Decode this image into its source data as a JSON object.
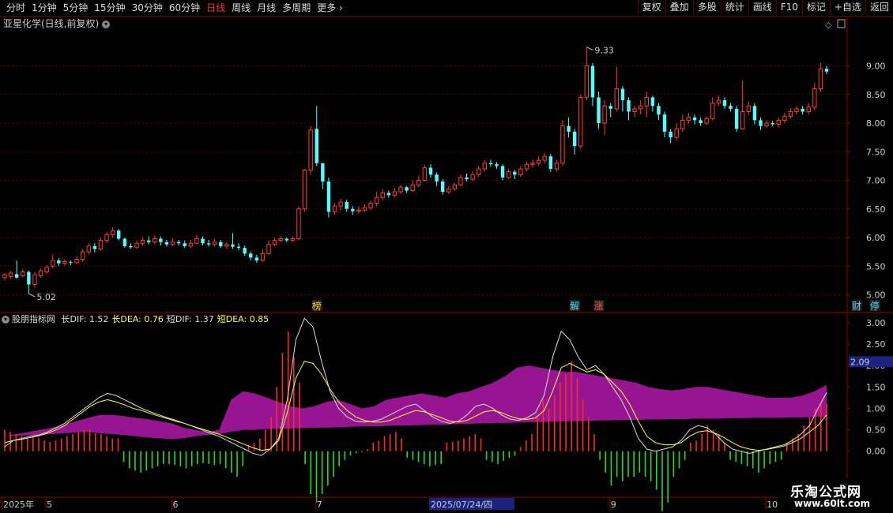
{
  "toolbar": {
    "periods": [
      "分时",
      "1分钟",
      "5分钟",
      "15分钟",
      "30分钟",
      "60分钟",
      "日线",
      "周线",
      "月线",
      "多周期",
      "更多"
    ],
    "active_period": "日线",
    "buttons": [
      "复权",
      "叠加",
      "多股",
      "统计",
      "画线",
      "F10",
      "标记",
      "+自选",
      "返回"
    ]
  },
  "stock_title": "亚星化学(日线,前复权)",
  "price_axis": [
    "9.00",
    "8.50",
    "8.00",
    "7.50",
    "7.00",
    "6.50",
    "6.00",
    "5.50",
    "5.00"
  ],
  "high_label": "9.33",
  "low_label": "5.02",
  "event_markers": [
    {
      "text": "榜",
      "color": "#ffcc33",
      "day": 52
    },
    {
      "text": "解",
      "color": "#55ddee",
      "day": 95
    },
    {
      "text": "涨",
      "color": "#ff5555",
      "day": 99
    },
    {
      "text": "财",
      "color": "#55ddee",
      "day": 142
    },
    {
      "text": "停",
      "color": "#55ddee",
      "day": 145
    }
  ],
  "indicator": {
    "name": "股朋指标网",
    "fields": [
      {
        "label": "长DIF: 1.52",
        "color": "#dddddd"
      },
      {
        "label": "长DEA: 0.76",
        "color": "#ffff33"
      },
      {
        "label": "短DIF: 1.37",
        "color": "#dddddd"
      },
      {
        "label": "短DEA: 0.85",
        "color": "#ffff33"
      }
    ],
    "axis": [
      "3.00",
      "2.50",
      "2.00",
      "1.50",
      "1.00",
      "0.50",
      "0.00"
    ],
    "current_value": "2.09"
  },
  "time_axis": [
    {
      "label": "2025年",
      "day": 0
    },
    {
      "label": "5",
      "day": 7
    },
    {
      "label": "6",
      "day": 28
    },
    {
      "label": "7",
      "day": 52
    },
    {
      "label": "2025/07/24/四",
      "day": 71,
      "highlight": true
    },
    {
      "label": "9",
      "day": 101
    },
    {
      "label": "10",
      "day": 127
    }
  ],
  "chart_data": {
    "type": "candlestick",
    "ylim": [
      4.8,
      9.6
    ],
    "candles": [
      [
        5.3,
        5.35,
        5.38,
        5.25
      ],
      [
        5.32,
        5.38,
        5.42,
        5.28
      ],
      [
        5.36,
        5.3,
        5.6,
        5.28
      ],
      [
        5.33,
        5.4,
        5.45,
        5.3
      ],
      [
        5.4,
        5.18,
        5.42,
        5.02
      ],
      [
        5.18,
        5.35,
        5.4,
        5.12
      ],
      [
        5.33,
        5.42,
        5.46,
        5.3
      ],
      [
        5.4,
        5.48,
        5.52,
        5.36
      ],
      [
        5.5,
        5.6,
        5.7,
        5.46
      ],
      [
        5.6,
        5.55,
        5.64,
        5.5
      ],
      [
        5.55,
        5.58,
        5.62,
        5.5
      ],
      [
        5.57,
        5.56,
        5.6,
        5.52
      ],
      [
        5.56,
        5.62,
        5.68,
        5.54
      ],
      [
        5.62,
        5.75,
        5.8,
        5.58
      ],
      [
        5.75,
        5.85,
        5.9,
        5.7
      ],
      [
        5.85,
        5.8,
        5.9,
        5.74
      ],
      [
        5.8,
        5.95,
        6.0,
        5.78
      ],
      [
        5.95,
        6.05,
        6.1,
        5.9
      ],
      [
        6.05,
        6.12,
        6.18,
        6.0
      ],
      [
        6.12,
        5.98,
        6.15,
        5.95
      ],
      [
        5.98,
        5.85,
        6.0,
        5.82
      ],
      [
        5.85,
        5.83,
        5.9,
        5.8
      ],
      [
        5.83,
        5.9,
        5.95,
        5.8
      ],
      [
        5.9,
        5.95,
        6.0,
        5.86
      ],
      [
        5.95,
        5.92,
        6.02,
        5.88
      ],
      [
        5.92,
        5.98,
        6.04,
        5.88
      ],
      [
        5.98,
        5.92,
        6.02,
        5.86
      ],
      [
        5.92,
        5.88,
        5.96,
        5.84
      ],
      [
        5.88,
        5.92,
        5.98,
        5.85
      ],
      [
        5.92,
        5.9,
        5.96,
        5.86
      ],
      [
        5.9,
        5.85,
        5.95,
        5.82
      ],
      [
        5.85,
        5.9,
        5.96,
        5.82
      ],
      [
        5.9,
        5.98,
        6.05,
        5.88
      ],
      [
        5.98,
        5.9,
        6.02,
        5.86
      ],
      [
        5.9,
        5.88,
        5.96,
        5.84
      ],
      [
        5.88,
        5.92,
        5.98,
        5.84
      ],
      [
        5.92,
        5.85,
        5.96,
        5.82
      ],
      [
        5.85,
        5.88,
        5.92,
        5.8
      ],
      [
        5.88,
        5.84,
        6.08,
        5.8
      ],
      [
        5.84,
        5.82,
        5.9,
        5.78
      ],
      [
        5.82,
        5.72,
        5.86,
        5.68
      ],
      [
        5.72,
        5.65,
        5.76,
        5.6
      ],
      [
        5.65,
        5.6,
        5.7,
        5.56
      ],
      [
        5.6,
        5.72,
        5.8,
        5.58
      ],
      [
        5.72,
        5.88,
        5.95,
        5.7
      ],
      [
        5.88,
        5.95,
        6.0,
        5.85
      ],
      [
        5.95,
        5.98,
        6.02,
        5.92
      ],
      [
        5.98,
        5.95,
        6.0,
        5.92
      ],
      [
        5.95,
        5.98,
        6.02,
        5.93
      ],
      [
        5.98,
        6.5,
        6.55,
        5.95
      ],
      [
        6.5,
        7.18,
        7.2,
        6.45
      ],
      [
        7.18,
        7.88,
        7.95,
        7.1
      ],
      [
        7.9,
        7.3,
        8.3,
        7.25
      ],
      [
        7.3,
        6.98,
        7.12,
        6.85
      ],
      [
        6.98,
        6.45,
        7.05,
        6.35
      ],
      [
        6.45,
        6.55,
        6.6,
        6.4
      ],
      [
        6.55,
        6.62,
        6.68,
        6.48
      ],
      [
        6.62,
        6.5,
        6.66,
        6.45
      ],
      [
        6.5,
        6.46,
        6.55,
        6.4
      ],
      [
        6.46,
        6.48,
        6.55,
        6.42
      ],
      [
        6.48,
        6.52,
        6.58,
        6.45
      ],
      [
        6.52,
        6.6,
        6.65,
        6.48
      ],
      [
        6.6,
        6.7,
        6.8,
        6.55
      ],
      [
        6.7,
        6.78,
        6.85,
        6.65
      ],
      [
        6.78,
        6.74,
        6.82,
        6.7
      ],
      [
        6.74,
        6.8,
        6.86,
        6.7
      ],
      [
        6.8,
        6.88,
        6.92,
        6.76
      ],
      [
        6.88,
        6.82,
        6.9,
        6.78
      ],
      [
        6.82,
        6.92,
        7.0,
        6.8
      ],
      [
        6.92,
        7.0,
        7.08,
        6.88
      ],
      [
        7.0,
        7.22,
        7.26,
        6.98
      ],
      [
        7.22,
        7.1,
        7.28,
        7.05
      ],
      [
        7.1,
        6.98,
        7.14,
        6.9
      ],
      [
        6.98,
        6.8,
        7.02,
        6.75
      ],
      [
        6.8,
        6.85,
        6.9,
        6.76
      ],
      [
        6.85,
        6.92,
        6.96,
        6.82
      ],
      [
        6.92,
        7.05,
        7.1,
        6.9
      ],
      [
        7.05,
        7.02,
        7.12,
        6.98
      ],
      [
        7.02,
        7.1,
        7.16,
        6.98
      ],
      [
        7.1,
        7.2,
        7.25,
        7.06
      ],
      [
        7.2,
        7.3,
        7.35,
        7.15
      ],
      [
        7.3,
        7.28,
        7.36,
        7.24
      ],
      [
        7.28,
        7.25,
        7.32,
        7.2
      ],
      [
        7.25,
        7.05,
        7.28,
        7.0
      ],
      [
        7.05,
        7.15,
        7.2,
        7.02
      ],
      [
        7.15,
        7.1,
        7.18,
        7.02
      ],
      [
        7.1,
        7.2,
        7.25,
        7.06
      ],
      [
        7.2,
        7.28,
        7.32,
        7.16
      ],
      [
        7.28,
        7.3,
        7.36,
        7.22
      ],
      [
        7.3,
        7.35,
        7.42,
        7.26
      ],
      [
        7.35,
        7.42,
        7.48,
        7.3
      ],
      [
        7.42,
        7.2,
        7.46,
        7.15
      ],
      [
        7.2,
        7.3,
        7.36,
        7.15
      ],
      [
        7.3,
        7.95,
        8.05,
        7.25
      ],
      [
        7.95,
        7.85,
        8.1,
        7.75
      ],
      [
        7.85,
        7.6,
        7.9,
        7.45
      ],
      [
        7.6,
        8.45,
        8.5,
        7.55
      ],
      [
        8.45,
        9.0,
        9.33,
        8.4
      ],
      [
        9.0,
        8.45,
        9.05,
        8.3
      ],
      [
        8.45,
        8.0,
        8.55,
        7.9
      ],
      [
        8.0,
        8.3,
        8.4,
        7.8
      ],
      [
        8.3,
        8.25,
        8.35,
        8.1
      ],
      [
        8.25,
        8.6,
        8.98,
        8.2
      ],
      [
        8.6,
        8.4,
        8.65,
        8.2
      ],
      [
        8.4,
        8.2,
        8.45,
        8.05
      ],
      [
        8.2,
        8.25,
        8.3,
        8.1
      ],
      [
        8.25,
        8.3,
        8.4,
        8.15
      ],
      [
        8.3,
        8.45,
        8.55,
        8.1
      ],
      [
        8.45,
        8.3,
        8.48,
        8.2
      ],
      [
        8.3,
        8.15,
        8.35,
        8.05
      ],
      [
        8.15,
        7.85,
        8.2,
        7.75
      ],
      [
        7.85,
        7.75,
        7.9,
        7.65
      ],
      [
        7.75,
        7.9,
        8.0,
        7.7
      ],
      [
        7.9,
        8.05,
        8.15,
        7.85
      ],
      [
        8.05,
        8.1,
        8.18,
        8.0
      ],
      [
        8.1,
        8.05,
        8.15,
        7.98
      ],
      [
        8.05,
        8.0,
        8.1,
        7.95
      ],
      [
        8.0,
        8.08,
        8.12,
        7.96
      ],
      [
        8.08,
        8.35,
        8.45,
        8.05
      ],
      [
        8.35,
        8.4,
        8.48,
        8.3
      ],
      [
        8.4,
        8.3,
        8.45,
        8.25
      ],
      [
        8.3,
        8.25,
        8.35,
        8.2
      ],
      [
        8.25,
        7.9,
        8.3,
        7.85
      ],
      [
        7.9,
        8.2,
        8.75,
        7.88
      ],
      [
        8.2,
        8.3,
        8.38,
        8.15
      ],
      [
        8.3,
        8.05,
        8.35,
        7.98
      ],
      [
        8.05,
        7.95,
        8.1,
        7.88
      ],
      [
        7.95,
        8.0,
        8.05,
        7.92
      ],
      [
        8.0,
        7.98,
        8.04,
        7.94
      ],
      [
        7.98,
        8.05,
        8.1,
        7.92
      ],
      [
        8.05,
        8.12,
        8.18,
        8.0
      ],
      [
        8.12,
        8.2,
        8.26,
        8.08
      ],
      [
        8.2,
        8.25,
        8.3,
        8.15
      ],
      [
        8.25,
        8.2,
        8.3,
        8.15
      ],
      [
        8.2,
        8.28,
        8.35,
        8.15
      ],
      [
        8.28,
        8.6,
        8.7,
        8.22
      ],
      [
        8.6,
        8.95,
        9.05,
        8.55
      ],
      [
        8.95,
        8.9,
        9.0,
        8.85
      ]
    ],
    "series": [
      {
        "name": "长DIF",
        "color": "#dddddd",
        "values": [
          0.1,
          0.25,
          0.3,
          0.35,
          0.38,
          0.45,
          0.55,
          0.65,
          0.8,
          0.95,
          1.1,
          1.25,
          1.35,
          1.3,
          1.2,
          1.1,
          1.0,
          0.92,
          0.85,
          0.78,
          0.72,
          0.65,
          0.58,
          0.5,
          0.42,
          0.35,
          0.25,
          0.15,
          0.05,
          -0.05,
          -0.1,
          0.05,
          0.3,
          1.2,
          2.6,
          3.1,
          2.9,
          2.1,
          1.4,
          1.0,
          0.8,
          0.7,
          0.68,
          0.7,
          0.75,
          0.85,
          0.95,
          1.05,
          1.1,
          0.95,
          0.8,
          0.7,
          0.65,
          0.7,
          0.85,
          1.05,
          1.1,
          1.0,
          0.85,
          0.75,
          0.72,
          0.78,
          0.9,
          1.3,
          2.2,
          2.8,
          2.6,
          2.2,
          1.9,
          2.0,
          1.8,
          1.5,
          1.2,
          0.8,
          0.3,
          0.05,
          0.0,
          0.05,
          0.1,
          0.25,
          0.5,
          0.6,
          0.55,
          0.4,
          0.2,
          0.05,
          0.0,
          -0.05,
          0.0,
          0.05,
          0.1,
          0.15,
          0.25,
          0.4,
          0.6,
          1.0,
          1.37
        ]
      },
      {
        "name": "长DEA",
        "color": "#ffff33",
        "values": [
          0.2,
          0.25,
          0.28,
          0.32,
          0.36,
          0.42,
          0.5,
          0.6,
          0.75,
          0.9,
          1.05,
          1.15,
          1.2,
          1.15,
          1.08,
          1.0,
          0.95,
          0.88,
          0.82,
          0.76,
          0.7,
          0.65,
          0.58,
          0.52,
          0.46,
          0.4,
          0.32,
          0.24,
          0.16,
          0.08,
          0.02,
          0.05,
          0.25,
          0.9,
          1.7,
          2.1,
          2.05,
          1.8,
          1.45,
          1.15,
          0.95,
          0.8,
          0.72,
          0.68,
          0.68,
          0.72,
          0.8,
          0.88,
          0.95,
          0.92,
          0.85,
          0.78,
          0.7,
          0.68,
          0.72,
          0.82,
          0.92,
          0.95,
          0.9,
          0.82,
          0.76,
          0.74,
          0.78,
          0.95,
          1.4,
          1.95,
          2.05,
          1.95,
          1.85,
          1.9,
          1.8,
          1.6,
          1.4,
          1.1,
          0.7,
          0.35,
          0.2,
          0.15,
          0.15,
          0.2,
          0.35,
          0.45,
          0.48,
          0.42,
          0.32,
          0.2,
          0.1,
          0.05,
          0.02,
          0.04,
          0.08,
          0.12,
          0.2,
          0.3,
          0.45,
          0.6,
          0.85
        ]
      }
    ],
    "histogram": [
      0.5,
      0.45,
      0.4,
      0.35,
      0.3,
      0.32,
      0.3,
      0.25,
      0.22,
      0.25,
      0.3,
      0.35,
      0.4,
      0.45,
      0.5,
      0.5,
      0.42,
      0.4,
      0.35,
      0.3,
      0.3,
      -0.25,
      -0.4,
      -0.45,
      -0.5,
      -0.45,
      -0.4,
      -0.35,
      -0.3,
      -0.3,
      -0.32,
      -0.35,
      -0.4,
      -0.35,
      -0.3,
      -0.28,
      -0.3,
      -0.32,
      -0.3,
      -0.4,
      -0.5,
      -0.6,
      -0.35,
      0.15,
      0.2,
      0.3,
      0.5,
      0.8,
      1.5,
      2.3,
      2.8,
      2.2,
      1.6,
      -0.3,
      -1.0,
      -1.2,
      -1.0,
      -0.8,
      -0.6,
      -0.35,
      -0.2,
      -0.1,
      -0.05,
      -0.02,
      0.05,
      0.2,
      0.25,
      0.35,
      0.4,
      0.45,
      0.3,
      -0.15,
      -0.2,
      -0.25,
      -0.3,
      -0.35,
      -0.32,
      -0.3,
      0.2,
      0.22,
      0.25,
      0.3,
      0.35,
      0.4,
      0.3,
      -0.2,
      -0.25,
      -0.3,
      -0.22,
      -0.15,
      -0.1,
      0.1,
      0.25,
      0.4,
      0.8,
      1.2,
      1.0,
      1.3,
      1.6,
      1.8,
      2.1,
      1.7,
      1.2,
      0.8,
      0.4,
      -0.2,
      -0.5,
      -0.8,
      -0.6,
      -0.7,
      -0.6,
      -0.6,
      -0.5,
      -0.6,
      -0.7,
      -0.9,
      -1.4,
      -1.2,
      -0.6,
      -0.4,
      -0.2,
      0.2,
      0.25,
      0.4,
      0.6,
      0.5,
      0.4,
      0.2,
      -0.2,
      -0.25,
      -0.3,
      -0.35,
      -0.4,
      -0.5,
      -0.4,
      -0.3,
      -0.25,
      -0.2,
      0.2,
      0.3,
      0.4,
      0.6,
      0.8,
      1.0,
      1.1,
      1.1
    ],
    "band_upper": [
      0.35,
      0.4,
      0.45,
      0.5,
      0.55,
      0.62,
      0.7,
      0.78,
      0.85,
      0.85,
      0.82,
      0.78,
      0.75,
      0.7,
      0.65,
      0.55,
      0.5,
      0.45,
      0.5,
      1.2,
      1.4,
      1.35,
      1.25,
      1.15,
      1.05,
      1.0,
      1.05,
      1.15,
      1.2,
      1.1,
      1.0,
      1.05,
      1.2,
      1.25,
      1.3,
      1.35,
      1.3,
      1.25,
      1.35,
      1.4,
      1.5,
      1.6,
      1.75,
      1.95,
      2.0,
      1.95,
      1.9,
      1.85,
      1.85,
      1.8,
      1.75,
      1.7,
      1.65,
      1.6,
      1.5,
      1.45,
      1.42,
      1.45,
      1.5,
      1.5,
      1.45,
      1.4,
      1.35,
      1.3,
      1.25,
      1.25,
      1.25,
      1.3,
      1.4,
      1.55
    ],
    "band_lower": [
      0.35,
      0.36,
      0.37,
      0.38,
      0.4,
      0.42,
      0.44,
      0.45,
      0.42,
      0.4,
      0.38,
      0.35,
      0.32,
      0.3,
      0.28,
      0.3,
      0.35,
      0.38,
      0.4,
      0.45,
      0.5,
      0.5,
      0.52,
      0.52,
      0.53,
      0.54,
      0.55,
      0.55,
      0.56,
      0.57,
      0.58,
      0.58,
      0.59,
      0.6,
      0.6,
      0.61,
      0.62,
      0.62,
      0.63,
      0.64,
      0.65,
      0.66,
      0.66,
      0.67,
      0.68,
      0.68,
      0.69,
      0.7,
      0.7,
      0.71,
      0.72,
      0.72,
      0.73,
      0.73,
      0.74,
      0.74,
      0.75,
      0.75,
      0.76,
      0.76,
      0.76,
      0.77,
      0.77,
      0.78,
      0.78,
      0.78,
      0.79,
      0.79,
      0.8,
      0.8
    ],
    "indicator_ylim": [
      -1.0,
      3.2
    ]
  },
  "watermark": {
    "line1": "乐淘公式网",
    "line2": "www.60lt.com"
  }
}
